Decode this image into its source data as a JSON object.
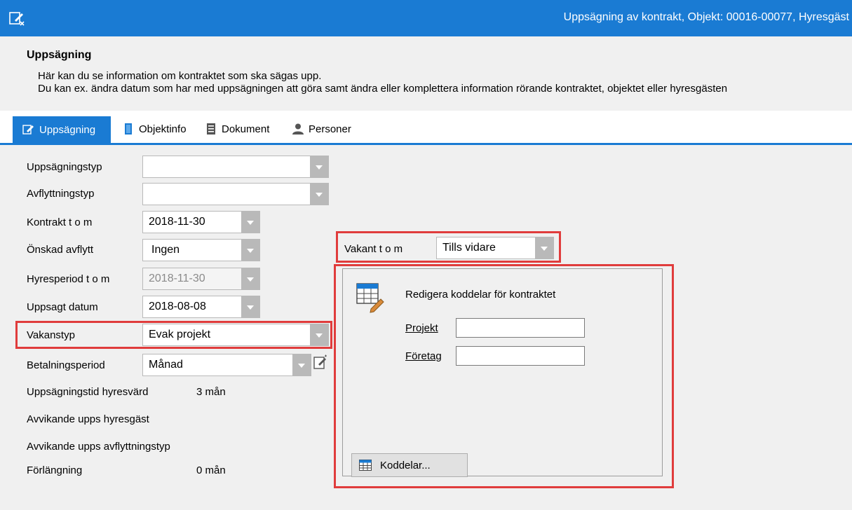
{
  "window": {
    "title": "Uppsägning av kontrakt, Objekt: 00016-00077, Hyresgäst"
  },
  "header": {
    "title": "Uppsägning",
    "desc_line1": "Här kan du se information om kontraktet som ska sägas upp.",
    "desc_line2": "Du kan ex. ändra datum som har med uppsägningen att göra samt ändra eller komplettera information rörande kontraktet, objektet eller hyresgästen"
  },
  "tabs": [
    {
      "label": "Uppsägning",
      "icon": "edit-contract-icon"
    },
    {
      "label": "Objektinfo",
      "icon": "door-icon"
    },
    {
      "label": "Dokument",
      "icon": "document-icon"
    },
    {
      "label": "Personer",
      "icon": "person-icon"
    }
  ],
  "form": {
    "uppsagningstyp": {
      "label": "Uppsägningstyp",
      "value": ""
    },
    "avflyttningstyp": {
      "label": "Avflyttningstyp",
      "value": ""
    },
    "kontrakt_tom": {
      "label": "Kontrakt t o m",
      "value": "2018-11-30"
    },
    "onskad_avflytt": {
      "label": "Önskad avflytt",
      "value": "Ingen"
    },
    "hyresperiod_tom": {
      "label": "Hyresperiod t o m",
      "value": "2018-11-30"
    },
    "uppsagt_datum": {
      "label": "Uppsagt datum",
      "value": "2018-08-08"
    },
    "vakanstyp": {
      "label": "Vakanstyp",
      "value": "Evak projekt"
    },
    "betalningsperiod": {
      "label": "Betalningsperiod",
      "value": "Månad"
    },
    "uppsagningstid_hyresvard": {
      "label": "Uppsägningstid hyresvärd",
      "value": "3 mån"
    },
    "avvikande_hyresgast": {
      "label": "Avvikande upps hyresgäst"
    },
    "avvikande_avflyttningstyp": {
      "label": "Avvikande upps avflyttningstyp"
    },
    "forlangning": {
      "label": "Förlängning",
      "value": "0 mån"
    },
    "vakant_tom": {
      "label": "Vakant t o m",
      "value": "Tills vidare"
    }
  },
  "koddelar": {
    "title": "Redigera koddelar för kontraktet",
    "projekt_label": "Projekt",
    "projekt_value": "",
    "foretag_label": "Företag",
    "foretag_value": "",
    "button_label": "Koddelar..."
  },
  "colors": {
    "accent": "#1a7bd3",
    "highlight": "#e03c3c"
  }
}
